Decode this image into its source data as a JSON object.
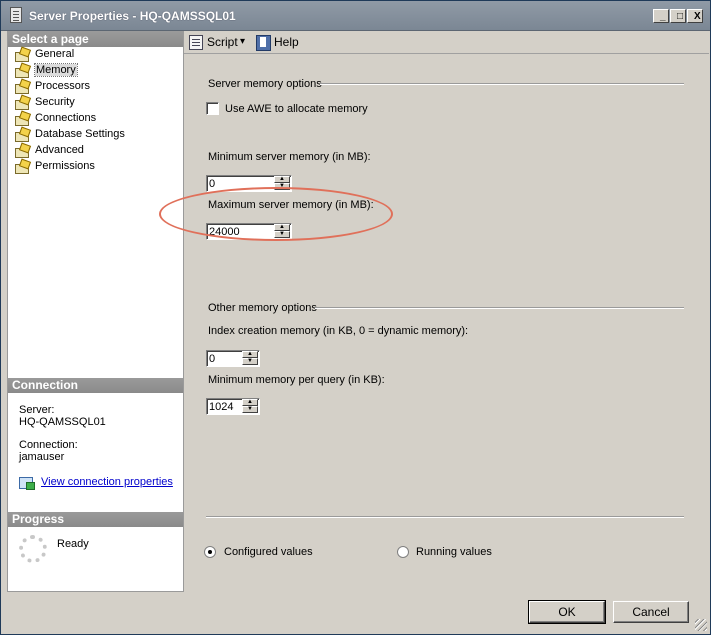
{
  "window": {
    "title": "Server Properties - HQ-QAMSSQL01",
    "min_label": "_",
    "max_label": "□",
    "close_label": "X"
  },
  "left": {
    "select_page_header": "Select a page",
    "pages": [
      {
        "label": "General"
      },
      {
        "label": "Memory"
      },
      {
        "label": "Processors"
      },
      {
        "label": "Security"
      },
      {
        "label": "Connections"
      },
      {
        "label": "Database Settings"
      },
      {
        "label": "Advanced"
      },
      {
        "label": "Permissions"
      }
    ],
    "selected_page": "Memory",
    "connection_header": "Connection",
    "server_label": "Server:",
    "server_value": "HQ-QAMSSQL01",
    "connection_label": "Connection:",
    "connection_value": "jamauser",
    "view_link": "View connection properties",
    "progress_header": "Progress",
    "progress_status": "Ready"
  },
  "toolbar": {
    "script_label": "Script",
    "script_arrow": "▾",
    "help_label": "Help"
  },
  "memory": {
    "server_group": "Server memory options",
    "awe_label": "Use AWE to allocate memory",
    "awe_checked": false,
    "min_label": "Minimum server memory (in MB):",
    "min_value": "0",
    "max_label": "Maximum server memory (in MB):",
    "max_value": "24000",
    "other_group": "Other memory options",
    "index_label": "Index creation memory (in KB, 0 = dynamic memory):",
    "index_value": "0",
    "query_label": "Minimum memory per query (in KB):",
    "query_value": "1024",
    "configured_label": "Configured values",
    "running_label": "Running values",
    "selected_mode": "configured"
  },
  "buttons": {
    "ok": "OK",
    "cancel": "Cancel"
  },
  "spin": {
    "up": "▲",
    "down": "▼"
  },
  "colors": {
    "title_bar": "#8490a0",
    "pane_header": "#909090",
    "highlight_ellipse": "#e0705a",
    "link": "#0000cc"
  }
}
